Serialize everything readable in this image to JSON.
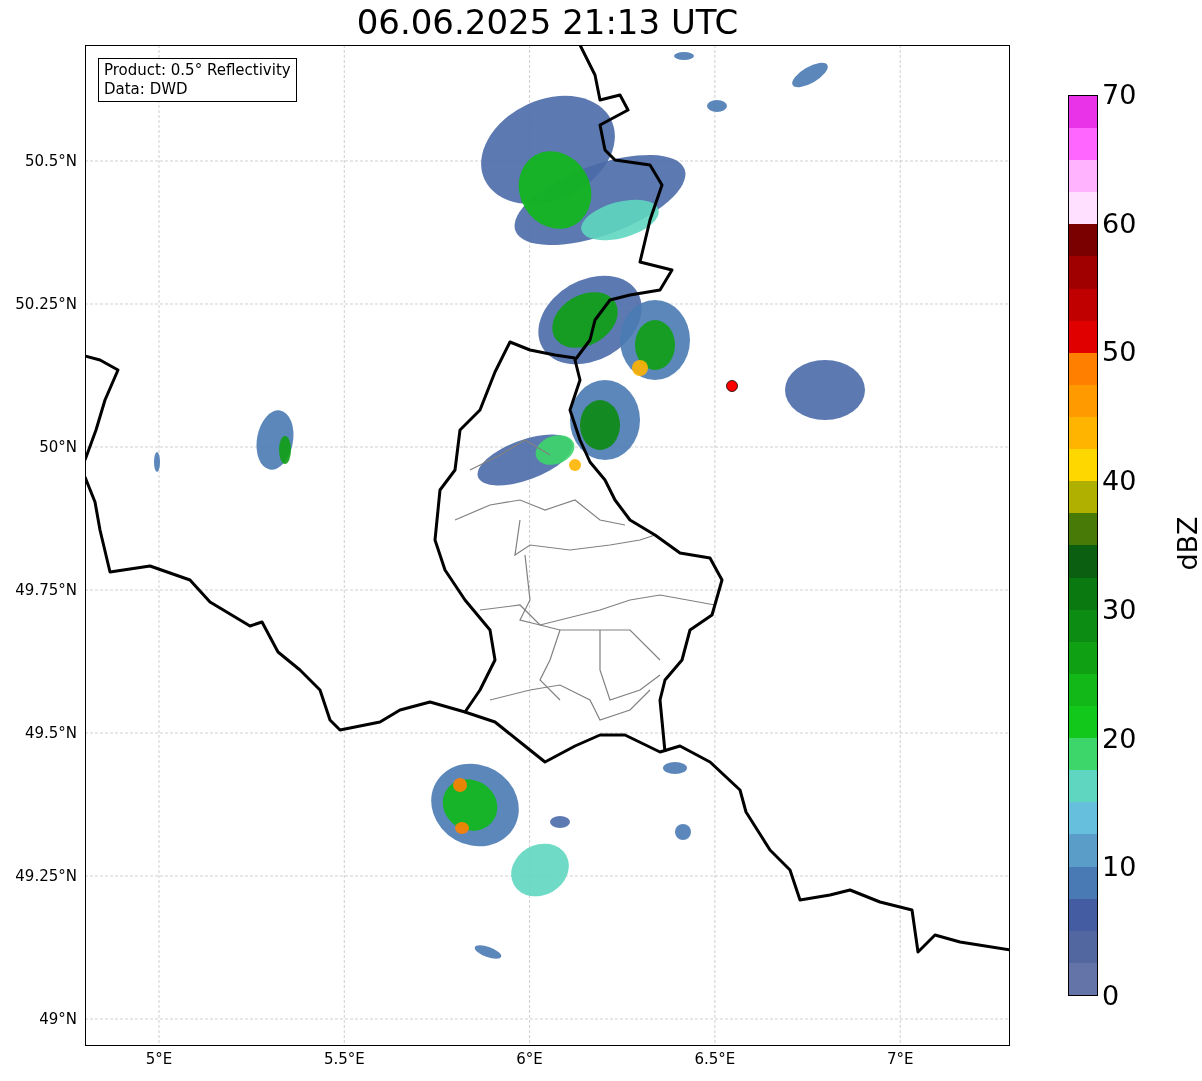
{
  "title": "06.06.2025 21:13 UTC",
  "info_box": [
    "Product: 0.5° Reflectivity",
    "Data: DWD"
  ],
  "lat_ticks": [
    "50.5°N",
    "50.25°N",
    "50°N",
    "49.75°N",
    "49.5°N",
    "49.25°N",
    "49°N"
  ],
  "lon_ticks": [
    "5°E",
    "5.5°E",
    "6°E",
    "6.5°E",
    "7°E"
  ],
  "colorbar": {
    "label": "dBZ",
    "ticks": [
      "70",
      "60",
      "50",
      "40",
      "30",
      "20",
      "10",
      "0"
    ],
    "segments": [
      {
        "color": "#6574a8"
      },
      {
        "color": "#52679f"
      },
      {
        "color": "#445da2"
      },
      {
        "color": "#4a7ab4"
      },
      {
        "color": "#5a9dc8"
      },
      {
        "color": "#66c0dd"
      },
      {
        "color": "#5fd6c0"
      },
      {
        "color": "#3dd66b"
      },
      {
        "color": "#12c81a"
      },
      {
        "color": "#12b818"
      },
      {
        "color": "#10a014"
      },
      {
        "color": "#0c8c12"
      },
      {
        "color": "#0a7a10"
      },
      {
        "color": "#0a6010"
      },
      {
        "color": "#487a08"
      },
      {
        "color": "#b0b000"
      },
      {
        "color": "#ffd700"
      },
      {
        "color": "#ffb400"
      },
      {
        "color": "#ff9a00"
      },
      {
        "color": "#ff7f00"
      },
      {
        "color": "#e00000"
      },
      {
        "color": "#c00000"
      },
      {
        "color": "#a00000"
      },
      {
        "color": "#7a0000"
      },
      {
        "color": "#ffe0ff"
      },
      {
        "color": "#ffb3ff"
      },
      {
        "color": "#ff66ff"
      },
      {
        "color": "#e833e8"
      }
    ]
  }
}
